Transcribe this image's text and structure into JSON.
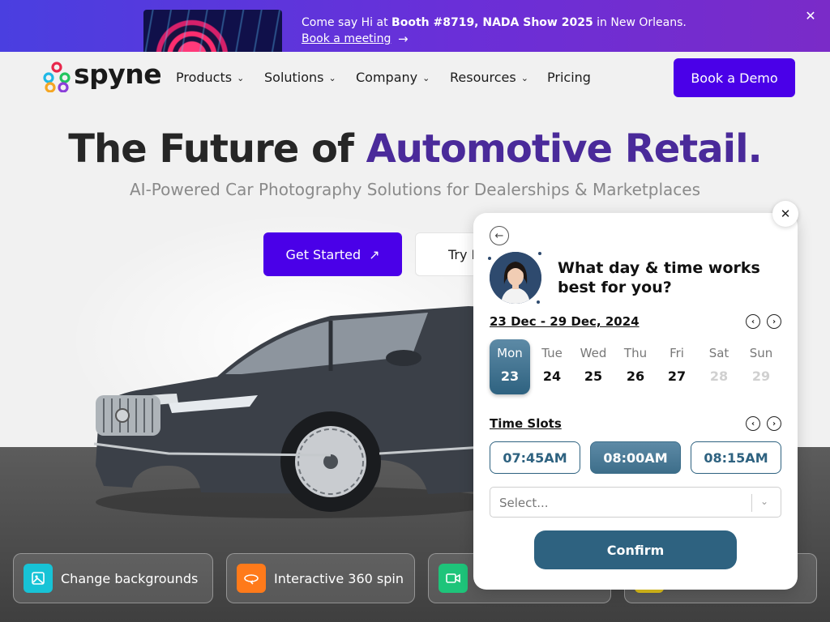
{
  "banner": {
    "text_pre": "Come say Hi at ",
    "text_bold": "Booth #8719, NADA Show 2025",
    "text_post": " in New Orleans.",
    "link": "Book a meeting",
    "arrow": "→",
    "close": "✕"
  },
  "nav": {
    "logo": "spyne",
    "items": [
      {
        "label": "Products",
        "chevron": "⌄"
      },
      {
        "label": "Solutions",
        "chevron": "⌄"
      },
      {
        "label": "Company",
        "chevron": "⌄"
      },
      {
        "label": "Resources",
        "chevron": "⌄"
      },
      {
        "label": "Pricing"
      }
    ],
    "cta": "Book a Demo"
  },
  "hero": {
    "title_part1": "The Future of ",
    "title_accent": "Automotive Retail.",
    "subtitle": "AI-Powered Car Photography Solutions for Dealerships & Marketplaces",
    "primary_cta": "Get Started",
    "primary_icon": "↗",
    "secondary_cta": "Try I"
  },
  "features": [
    {
      "label": "Change backgrounds",
      "icon": "image-icon",
      "color": "#17c3d6"
    },
    {
      "label": "Interactive 360 spin",
      "icon": "spin-360-icon",
      "color": "#ff7a1a"
    },
    {
      "label": "",
      "icon": "video-icon",
      "color": "#1ec47a"
    },
    {
      "label": "",
      "icon": "feature-icon",
      "color": "#e0c21a"
    }
  ],
  "scheduler": {
    "close": "✕",
    "back": "←",
    "question": "What day & time works best for you?",
    "range": "23 Dec - 29 Dec, 2024",
    "prev": "‹",
    "next": "›",
    "days": [
      {
        "name": "Mon",
        "date": "23",
        "state": "selected"
      },
      {
        "name": "Tue",
        "date": "24",
        "state": "available"
      },
      {
        "name": "Wed",
        "date": "25",
        "state": "available"
      },
      {
        "name": "Thu",
        "date": "26",
        "state": "available"
      },
      {
        "name": "Fri",
        "date": "27",
        "state": "available"
      },
      {
        "name": "Sat",
        "date": "28",
        "state": "disabled"
      },
      {
        "name": "Sun",
        "date": "29",
        "state": "disabled"
      }
    ],
    "slots_title": "Time Slots",
    "slots": [
      {
        "time": "07:45AM",
        "selected": false
      },
      {
        "time": "08:00AM",
        "selected": true
      },
      {
        "time": "08:15AM",
        "selected": false
      }
    ],
    "select_placeholder": "Select...",
    "select_arrow": "⌄",
    "confirm": "Confirm",
    "accent": "#2e6280"
  }
}
